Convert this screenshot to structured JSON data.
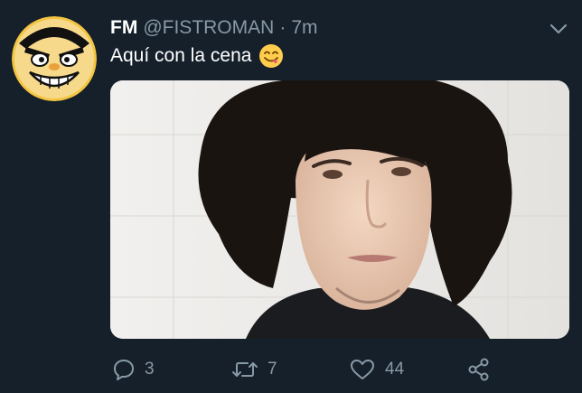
{
  "tweet": {
    "display_name": "FM",
    "handle": "@FISTROMAN",
    "separator": "·",
    "time": "7m",
    "text": "Aquí con la cena",
    "emoji": "savoring-food-emoji"
  },
  "actions": {
    "replies": "3",
    "retweets": "7",
    "likes": "44"
  },
  "icons": {
    "reply": "reply-icon",
    "retweet": "retweet-icon",
    "like": "heart-icon",
    "share": "share-icon",
    "menu": "chevron-down-icon"
  },
  "colors": {
    "background": "#15202b",
    "secondary_text": "#8899a6",
    "primary_text": "#ffffff"
  }
}
